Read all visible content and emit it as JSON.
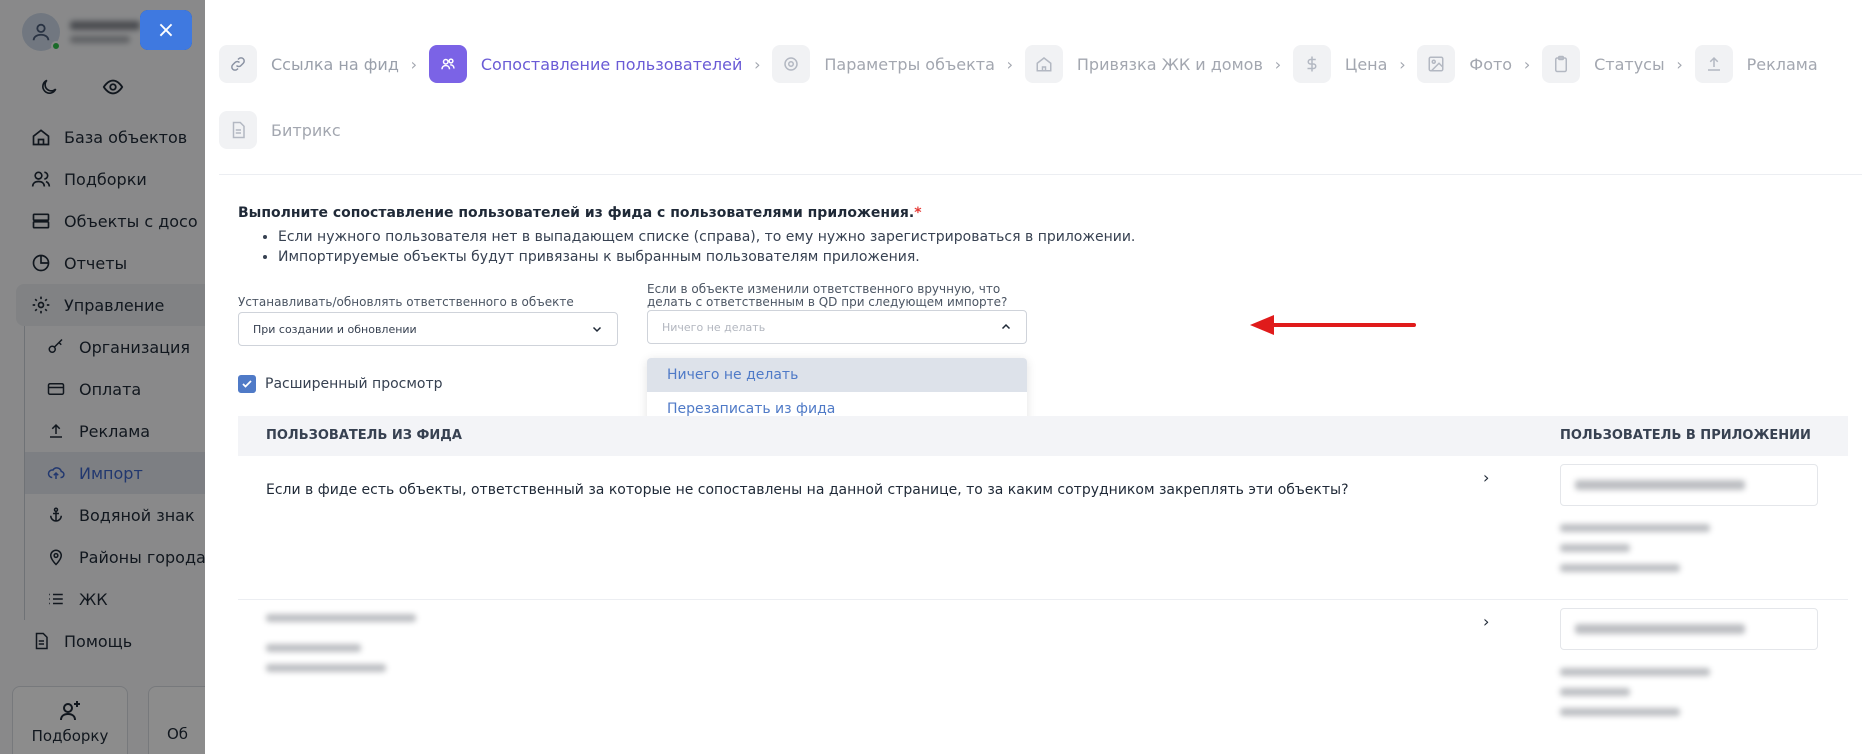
{
  "sidebar": {
    "close_symbol": "×",
    "nav": [
      {
        "label": "База объектов",
        "icon": "home-icon"
      },
      {
        "label": "Подборки",
        "icon": "users-icon"
      },
      {
        "label": "Объекты с досо",
        "icon": "database-icon"
      },
      {
        "label": "Отчеты",
        "icon": "pie-chart-icon"
      },
      {
        "label": "Управление",
        "icon": "gear-icon"
      }
    ],
    "subnav": [
      {
        "label": "Организация",
        "icon": "key-icon"
      },
      {
        "label": "Оплата",
        "icon": "card-icon"
      },
      {
        "label": "Реклама",
        "icon": "upload-icon"
      },
      {
        "label": "Импорт",
        "icon": "cloud-upload-icon"
      },
      {
        "label": "Водяной знак",
        "icon": "anchor-icon"
      },
      {
        "label": "Районы города",
        "icon": "map-pin-icon"
      },
      {
        "label": "ЖК",
        "icon": "list-icon"
      }
    ],
    "help": "Помощь",
    "tiles": [
      {
        "label": "Подборку"
      },
      {
        "label": "Об"
      }
    ]
  },
  "steps": {
    "chevron": "›",
    "row1": [
      {
        "label": "Ссылка на фид",
        "state": "done",
        "icon": "link-icon"
      },
      {
        "label": "Сопоставление пользователей",
        "state": "active",
        "icon": "users-icon"
      },
      {
        "label": "Параметры объекта",
        "state": "pending",
        "icon": "gear-icon"
      },
      {
        "label": "Привязка ЖК и домов",
        "state": "pending",
        "icon": "home-icon"
      },
      {
        "label": "Цена",
        "state": "pending",
        "icon": "dollar-icon"
      },
      {
        "label": "Фото",
        "state": "pending",
        "icon": "image-icon"
      },
      {
        "label": "Статусы",
        "state": "pending",
        "icon": "clipboard-icon"
      },
      {
        "label": "Реклама",
        "state": "pending",
        "icon": "upload-icon"
      }
    ],
    "row2": [
      {
        "label": "Битрикс",
        "state": "pending",
        "icon": "document-icon"
      }
    ]
  },
  "content": {
    "heading": "Выполните сопоставление пользователей из фида с пользователями приложения.",
    "required_mark": "*",
    "bullets": [
      "Если нужного пользователя нет в выпадающем списке (справа), то ему нужно зарегистрироваться в приложении.",
      "Импортируемые объекты будут привязаны к выбранным пользователям приложения."
    ],
    "field1": {
      "label": "Устанавливать/обновлять ответственного в объекте",
      "value": "При создании и обновлении"
    },
    "field2": {
      "label_line1": "Если в объекте изменили ответственного вручную, что",
      "label_line2": "делать с ответственным в QD при следующем импорте?",
      "placeholder": "Ничего не делать"
    },
    "dropdown_options": [
      "Ничего не делать",
      "Перезаписать из фида"
    ],
    "checkbox_label": "Расширенный просмотр",
    "table": {
      "col1": "ПОЛЬЗОВАТЕЛЬ ИЗ ФИДА",
      "col2": "ПОЛЬЗОВАТЕЛЬ В ПРИЛОЖЕНИИ",
      "row1_question": "Если в фиде есть объекты, ответственный за которые не сопоставлены на данной странице, то за каким сотрудником закреплять эти объекты?"
    }
  },
  "colors": {
    "accent": "#7b63e6",
    "link": "#4f7ac7",
    "annotation": "#e01b1b"
  }
}
